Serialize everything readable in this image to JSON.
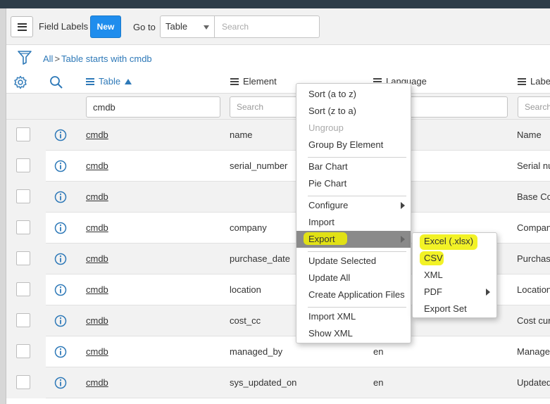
{
  "header": {
    "list_title": "Field Labels",
    "new_label": "New",
    "goto_label": "Go to",
    "goto_selected": "Table",
    "search_placeholder": "Search"
  },
  "breadcrumb": {
    "root": "All",
    "separator": ">",
    "filter": "Table starts with cmdb"
  },
  "columns": {
    "table": "Table",
    "element": "Element",
    "language": "Language",
    "label": "Label"
  },
  "filters": {
    "table_value": "cmdb",
    "placeholder": "Search"
  },
  "rows": [
    {
      "table": "cmdb",
      "element": "name",
      "language": "",
      "label": "Name"
    },
    {
      "table": "cmdb",
      "element": "serial_number",
      "language": "",
      "label": "Serial nu"
    },
    {
      "table": "cmdb",
      "element": "",
      "language": "",
      "label": "Base Con"
    },
    {
      "table": "cmdb",
      "element": "company",
      "language": "",
      "label": "Compan"
    },
    {
      "table": "cmdb",
      "element": "purchase_date",
      "language": "",
      "label": "Purchase"
    },
    {
      "table": "cmdb",
      "element": "location",
      "language": "",
      "label": "Location"
    },
    {
      "table": "cmdb",
      "element": "cost_cc",
      "language": "",
      "label": "Cost cur"
    },
    {
      "table": "cmdb",
      "element": "managed_by",
      "language": "en",
      "label": "Managed"
    },
    {
      "table": "cmdb",
      "element": "sys_updated_on",
      "language": "en",
      "label": "Updated"
    }
  ],
  "context_menu": {
    "sort_az": "Sort (a to z)",
    "sort_za": "Sort (z to a)",
    "ungroup": "Ungroup",
    "group_by": "Group By Element",
    "bar_chart": "Bar Chart",
    "pie_chart": "Pie Chart",
    "configure": "Configure",
    "import": "Import",
    "export": "Export",
    "update_selected": "Update Selected",
    "update_all": "Update All",
    "create_app_files": "Create Application Files",
    "import_xml": "Import XML",
    "show_xml": "Show XML"
  },
  "export_submenu": {
    "excel": "Excel (.xlsx)",
    "csv": "CSV",
    "xml": "XML",
    "pdf": "PDF",
    "export_set": "Export Set"
  },
  "colors": {
    "accent": "#1f8ded",
    "link": "#2e79b8",
    "highlight": "#f0f000",
    "menu_selected": "#8a8a8a"
  }
}
